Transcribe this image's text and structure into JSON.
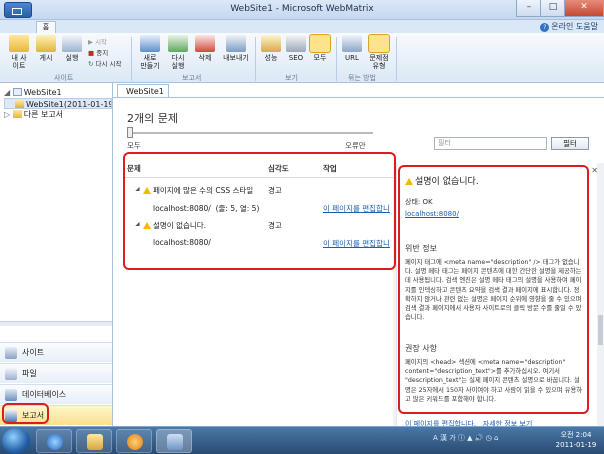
{
  "window": {
    "title": "WebSite1 - Microsoft WebMatrix",
    "home_tab": "홈",
    "help": "온라인 도움말",
    "minimize": "–",
    "maximize": "□",
    "close": "✕"
  },
  "ribbon": {
    "buttons": [
      {
        "label1": "내 사",
        "label2": "이트",
        "icon": "my-site-icon"
      },
      {
        "label1": "게시",
        "label2": "",
        "icon": "publish-icon"
      },
      {
        "label1": "실행",
        "label2": "",
        "icon": "run-icon"
      },
      {
        "label1": "새로",
        "label2": "만들기",
        "icon": "new-report-icon"
      },
      {
        "label1": "다시",
        "label2": "실행",
        "icon": "rerun-icon"
      },
      {
        "label1": "삭제",
        "label2": "",
        "icon": "delete-icon"
      },
      {
        "label1": "내보내기",
        "label2": "",
        "icon": "export-icon"
      },
      {
        "label1": "성능",
        "label2": "",
        "icon": "performance-icon"
      },
      {
        "label1": "SEO",
        "label2": "",
        "icon": "seo-icon"
      },
      {
        "label1": "모두",
        "label2": "",
        "icon": "all-icon"
      },
      {
        "label1": "URL",
        "label2": "",
        "icon": "url-icon"
      },
      {
        "label1": "문제점",
        "label2": "유형",
        "icon": "issue-type-icon"
      }
    ],
    "small": [
      "시작",
      "중지",
      "다시 시작"
    ],
    "groups": [
      "사이트",
      "보고서",
      "보기",
      "묶는 방법"
    ]
  },
  "tree": {
    "root": "WebSite1",
    "item": "WebSite1(2011-01-19 오",
    "other": "다른 보고서"
  },
  "nav": [
    "사이트",
    "파일",
    "데이터베이스",
    "보고서"
  ],
  "main": {
    "tab": "WebSite1",
    "title": "2개의 문제",
    "slider_left": "모두",
    "slider_right": "오류만",
    "filter_placeholder": "필터",
    "filter_button": "필터"
  },
  "grid": {
    "headers": [
      "문제",
      "심각도",
      "작업"
    ],
    "rows": [
      {
        "issue": "페이지에 많은 수의 CSS 스타일",
        "severity": "경고",
        "url": "localhost:8080/",
        "pos": "(줄: 5, 열: 5)",
        "action": "이 페이지를 편집합니"
      },
      {
        "issue": "설명이 없습니다.",
        "severity": "경고",
        "url": "localhost:8080/",
        "pos": "",
        "action": "이 페이지를 편집합니"
      }
    ]
  },
  "detail": {
    "title": "설명이 없습니다.",
    "status": "상태: OK",
    "url": "localhost:8080/",
    "violation_heading": "위반 정보",
    "violation_text": "페이지 태그에 <meta name=\"description\" /> 태그가 없습니다. 설명 메타 태그는 페이지 콘텐츠에 대한 간단한 설명을 제공하는 데 사용됩니다. 검색 엔진은 설명 메타 태그의 설명을 사용하여 페이지를 인덱싱하고 콘텐츠 요약을 검색 결과 페이지에 표시합니다. 정확하지 않거나 관련 없는 설명은 페이지 순위에 영향을 줄 수 있으며 검색 결과 페이지에서 사용자 사이트로의 클릭 방문 수를 줄일 수 있습니다.",
    "recommend_heading": "권장 사항",
    "recommend_text": "페이지의 <head> 섹션에 <meta name=\"description\" content=\"description_text\">를 추가하십시오. 여기서 \"description_text\"는 실제 페이지 콘텐츠 설명으로 바꿉니다. 설명은 25자에서 150자 사이여야 하고 사람이 읽을 수 있으며 유용하고 많은 키워드를 포함해야 합니다.",
    "link_edit": "이 페이지를 편집합니다.",
    "link_more": "자세한 정보 보기"
  },
  "taskbar": {
    "tray": "A 漢 가 ⓘ ▲ 🔊 ◷ ⌂",
    "time": "오전 2:04",
    "date": "2011-01-19"
  }
}
